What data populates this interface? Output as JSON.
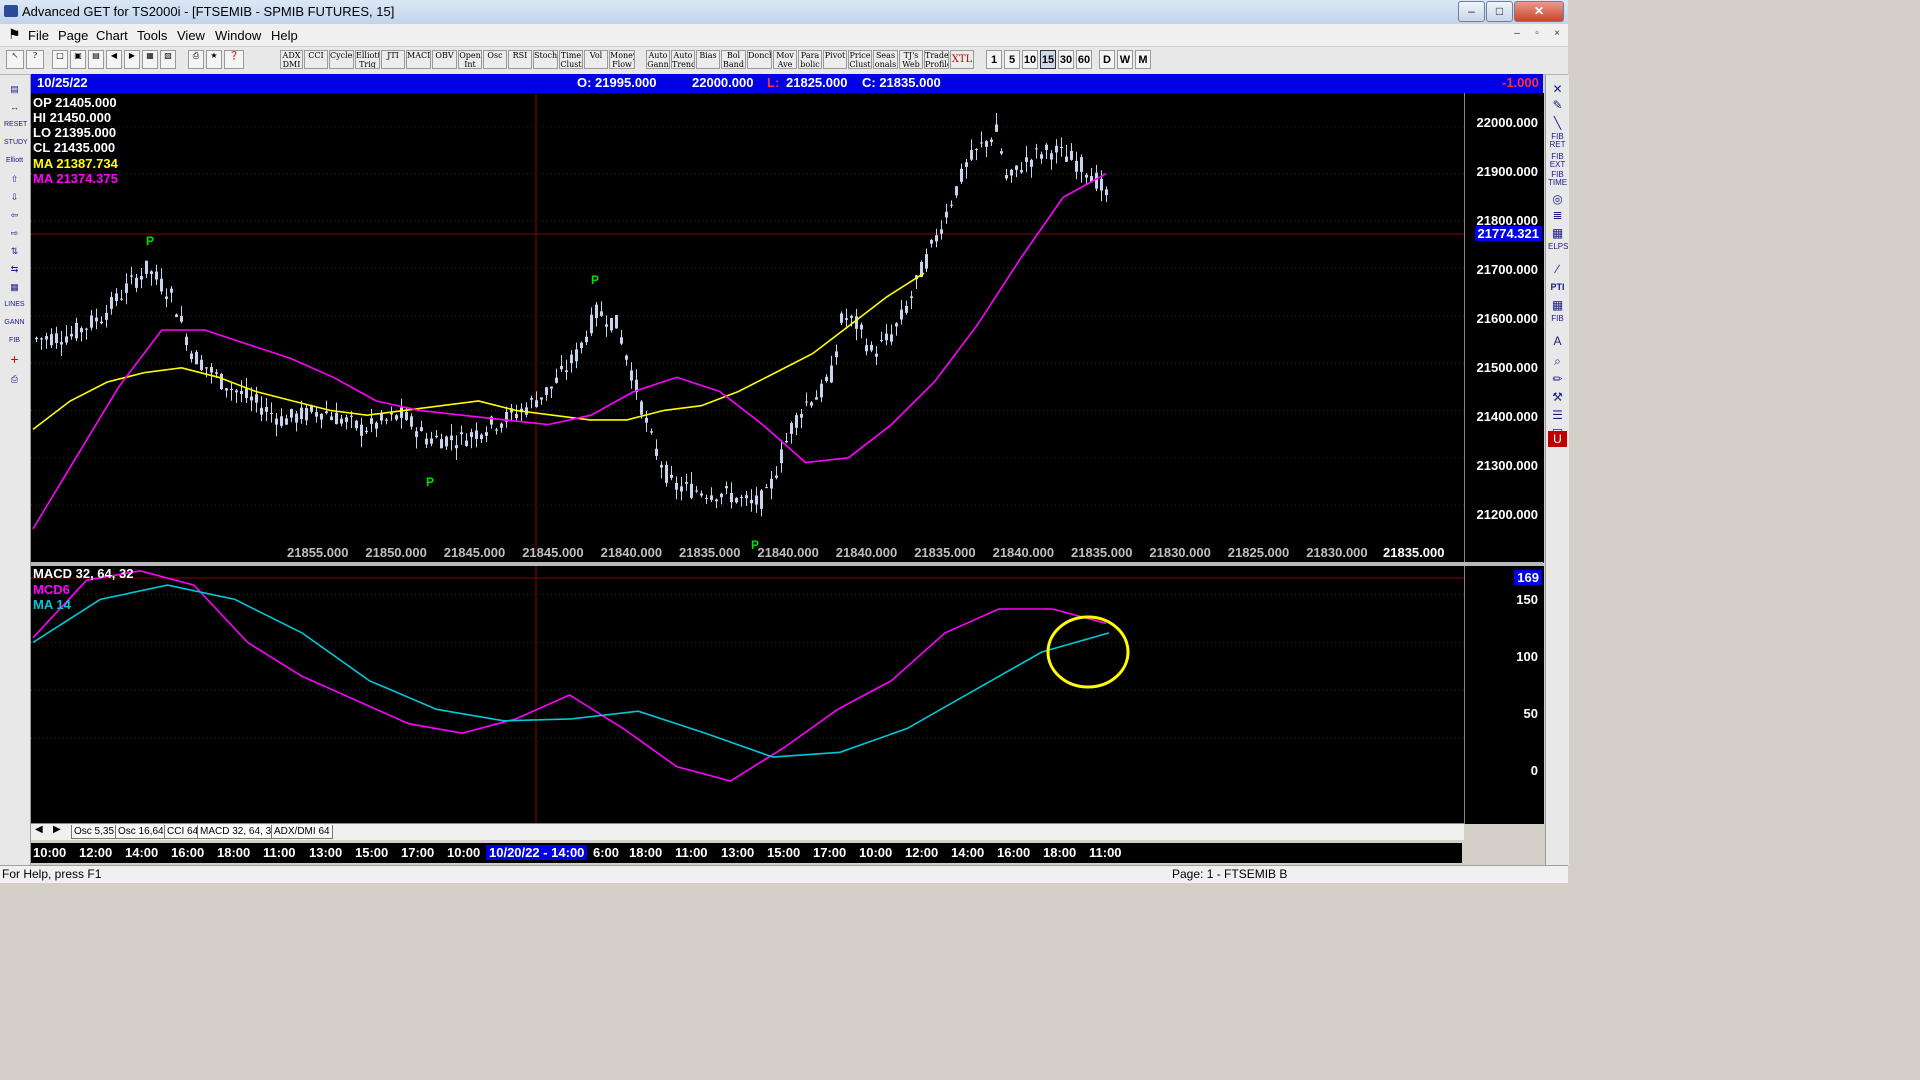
{
  "window": {
    "title": "Advanced GET for TS2000i - [FTSEMIB - SPMIB FUTURES, 15]",
    "minimize": "–",
    "maximize": "□",
    "close": "✕"
  },
  "menu": {
    "items": [
      "File",
      "Page",
      "Chart",
      "Tools",
      "View",
      "Window",
      "Help"
    ],
    "mdi": [
      "–",
      "▫",
      "×"
    ]
  },
  "toolbar": {
    "indicators": [
      "ADX DMI",
      "CCI",
      "Cycles",
      "Elliott Trig",
      "JTI",
      "MACD",
      "OBV",
      "Open Int",
      "Osc",
      "RSI",
      "Stoch",
      "Time Clust",
      "Vol",
      "Money Flow",
      "Auto Gann",
      "Auto Trend",
      "Bias",
      "Bol Band",
      "Donch",
      "Mov Ave",
      "Para bolic",
      "Pivot",
      "Price Clust",
      "Seas onals",
      "TJ's Web",
      "Trade Profile",
      "XTL"
    ],
    "periods": [
      "1",
      "5",
      "10",
      "15",
      "30",
      "60",
      "D",
      "W",
      "M"
    ],
    "active_period": "15"
  },
  "info": {
    "date": "10/25/22",
    "open": "O: 21995.000",
    "high": "22000.000",
    "low_label": "L:",
    "low": "21825.000",
    "close": "C: 21835.000",
    "change": "-1.000"
  },
  "legend": {
    "op": "OP  21405.000",
    "hi": "HI   21450.000",
    "lo": "LO  21395.000",
    "cl": "CL  21435.000",
    "ma1": "MA  21387.734",
    "ma2": "MA  21374.375"
  },
  "price_axis": {
    "labels": [
      "22000.000",
      "21900.000",
      "21800.000",
      "21700.000",
      "21600.000",
      "21500.000",
      "21400.000",
      "21300.000",
      "21200.000"
    ],
    "cursor": "21774.321"
  },
  "pivot_marker": "P",
  "pivots_bottom_row": [
    "21855.000",
    "21850.000",
    "21845.000",
    "21845.000",
    "21840.000",
    "21835.000",
    "21840.000",
    "21840.000",
    "21835.000",
    "21840.000",
    "21835.000",
    "21830.000",
    "21825.000",
    "21830.000"
  ],
  "pivots_bottom_last": "21835.000",
  "macd": {
    "title": "MACD 32, 64, 32",
    "mcd": "MCD6",
    "ma": "MA    14",
    "axis": [
      "150",
      "100",
      "50",
      "0"
    ],
    "cursor": "169"
  },
  "tabs": [
    "Osc 5,35",
    "Osc 16,64",
    "CCI 64",
    "MACD 32, 64, 32",
    "ADX/DMI 64"
  ],
  "time_axis": [
    "10:00",
    "12:00",
    "14:00",
    "16:00",
    "18:00",
    "11:00",
    "13:00",
    "15:00",
    "17:00",
    "10:00",
    "10/20/22 - 14:00",
    "6:00",
    "18:00",
    "11:00",
    "13:00",
    "15:00",
    "17:00",
    "10:00",
    "12:00",
    "14:00",
    "16:00",
    "18:00",
    "11:00"
  ],
  "status": {
    "help": "For Help, press F1",
    "page": "Page: 1 - FTSEMIB B"
  },
  "colors": {
    "background": "#000000",
    "candle": "#c8d4ee",
    "ma_yellow": "#ffff00",
    "ma_magenta": "#ff00ff",
    "macd_cyan": "#00c8d8",
    "pivot_green": "#00e000",
    "annotation": "#ffff00",
    "info_blue": "#0000e6"
  },
  "chart_data": {
    "type": "candlestick",
    "title": "FTSEMIB - SPMIB FUTURES, 15",
    "ylim": [
      21120,
      22060
    ],
    "ma_yellow": [
      21360,
      21420,
      21460,
      21480,
      21490,
      21470,
      21440,
      21420,
      21400,
      21390,
      21400,
      21410,
      21420,
      21400,
      21390,
      21380,
      21380,
      21400,
      21410,
      21440,
      21480,
      21520,
      21580,
      21640,
      21690
    ],
    "ma_magenta": [
      21150,
      21300,
      21450,
      21570,
      21570,
      21540,
      21510,
      21470,
      21420,
      21400,
      21390,
      21380,
      21370,
      21390,
      21440,
      21470,
      21440,
      21370,
      21290,
      21300,
      21370,
      21460,
      21580,
      21720,
      21850,
      21900
    ],
    "macd_ylim": [
      -90,
      180
    ],
    "macd_line": [
      105,
      165,
      175,
      160,
      100,
      65,
      40,
      15,
      5,
      20,
      45,
      10,
      -30,
      -45,
      -10,
      30,
      60,
      110,
      135,
      135,
      120
    ],
    "macd_signal": [
      100,
      145,
      160,
      145,
      110,
      60,
      30,
      18,
      20,
      28,
      5,
      -20,
      -15,
      10,
      50,
      90,
      110
    ]
  }
}
